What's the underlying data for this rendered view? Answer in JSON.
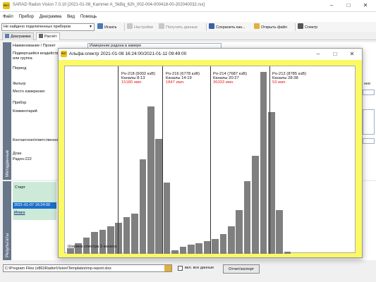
{
  "app": {
    "title": "SARAD Radon Vision 7.0.10 [2021-01-08_Kammer A_SkBq_62h_002-004-000418-00-202040032.rsx]",
    "icon_text": "RV7"
  },
  "menu": [
    "Файл",
    "Прибор",
    "Диаграмма",
    "Вид",
    "Помощь"
  ],
  "toolbar": {
    "device_combo": "Не найдено подключенных приборов",
    "search": "Искать",
    "settings": "Настройки",
    "get_data": "Получить данные",
    "save": "Сохранить как...",
    "open": "Открыть файл",
    "spectrum": "Спектр"
  },
  "tabs": [
    "Диаграмма",
    "Расчёт"
  ],
  "metadata": {
    "section_label": "Метаданные",
    "labels": {
      "name": "Наименование / Проект",
      "exposed": "Подвергшийся воздействию",
      "group": "или группа",
      "period": "Период",
      "filter": "Фильтр",
      "place": "Место измерения",
      "device": "Прибор",
      "comment": "Комментарий",
      "contact": "Контактное/ответственное",
      "dose": "Доза",
      "radon": "Радон-222"
    },
    "name_value": "Измерение радона в камере",
    "right_fragment": "нно"
  },
  "results": {
    "section_label": "Результаты",
    "header": "Старт",
    "row_value": "2021-01-07 16:24:00",
    "total_label": "Итого"
  },
  "bottom": {
    "template_path": "C:\\Program Files (x86)\\RadonVision\\Templates\\mp-report.xlsx",
    "checkbox_label": "вкл. все данные",
    "export_button": "Отчет/экспорт"
  },
  "dialog": {
    "title": "Альфа-спектр 2021-01-08 16:24:00/2021-01-11 09:49:00",
    "footnote": "Ширина спектра 3 канала",
    "peaks": [
      {
        "name": "Po-218 (6002 кэВ)",
        "channels": "Каналы 8:13",
        "imp": "15180 имп."
      },
      {
        "name": "Po-216 (6778 кэВ)",
        "channels": "Каналы 14:19",
        "imp": "1847 имп."
      },
      {
        "name": "Po-214 (7687 кэВ)",
        "channels": "Каналы 20:27",
        "imp": "36333 имп."
      },
      {
        "name": "Po-212 (8785 кэВ)",
        "channels": "Каналы 28:38",
        "imp": "53 имп."
      }
    ]
  },
  "chart_data": {
    "type": "bar",
    "x": [
      1,
      2,
      3,
      4,
      5,
      6,
      7,
      8,
      9,
      10,
      11,
      12,
      13,
      14,
      15,
      16,
      17,
      18,
      19,
      20,
      21,
      22,
      23,
      24,
      25,
      26,
      27,
      28
    ],
    "values": [
      3,
      6,
      9,
      12,
      13,
      15,
      17,
      20,
      22,
      52,
      81,
      63,
      39,
      2,
      4,
      5,
      6,
      7,
      8,
      11,
      15,
      24,
      40,
      54,
      100,
      78,
      24,
      1
    ],
    "ylim": [
      0,
      100
    ]
  }
}
